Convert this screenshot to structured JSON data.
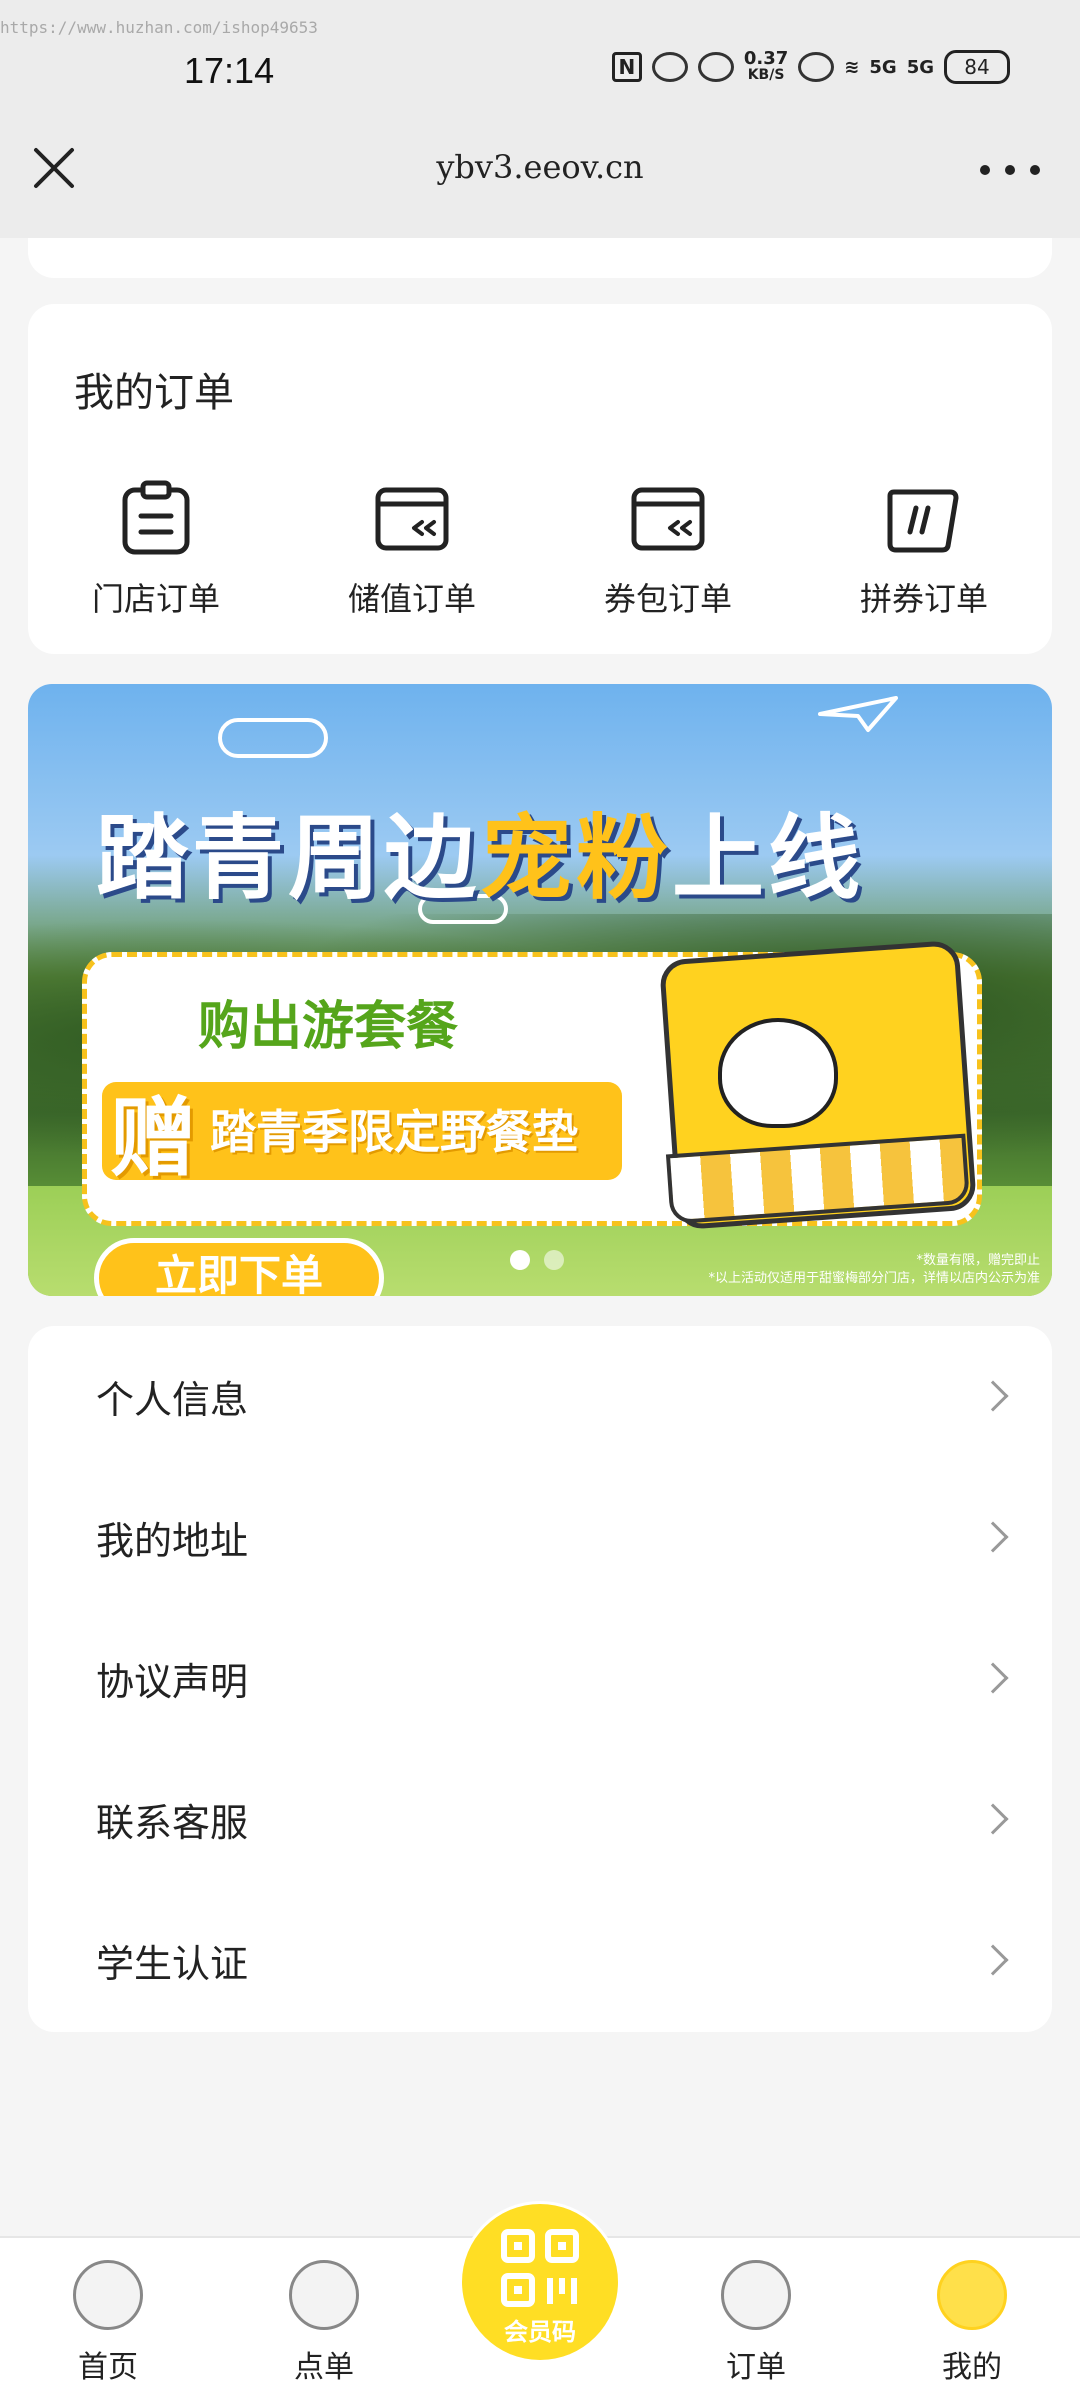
{
  "watermark": "https://www.huzhan.com/ishop49653",
  "status_bar": {
    "time": "17:14",
    "net_speed_value": "0.37",
    "net_speed_unit": "KB/S",
    "signal_1": "5G",
    "signal_2": "5G",
    "battery": "84"
  },
  "browser": {
    "url": "ybv3.eeov.cn"
  },
  "orders": {
    "title": "我的订单",
    "items": [
      {
        "label": "门店订单",
        "icon": "clipboard-icon"
      },
      {
        "label": "储值订单",
        "icon": "card-rewind-icon"
      },
      {
        "label": "券包订单",
        "icon": "card-rewind-icon"
      },
      {
        "label": "拼券订单",
        "icon": "ticket-icon"
      }
    ]
  },
  "banner": {
    "headline_part1": "踏青周边",
    "headline_highlight": "宠粉",
    "headline_part2": "上线",
    "subtitle": "购出游套餐",
    "gift_char": "赠",
    "gift_text": "踏青季限定野餐垫",
    "cta": "立即下单",
    "fine_print_1": "*数量有限，赠完即止",
    "fine_print_2": "*以上活动仅适用于甜蜜梅部分门店，详情以店内公示为准",
    "page_count": 2,
    "active_page": 1,
    "accent_color": "#ffc21a"
  },
  "menu": {
    "items": [
      {
        "label": "个人信息"
      },
      {
        "label": "我的地址"
      },
      {
        "label": "协议声明"
      },
      {
        "label": "联系客服"
      },
      {
        "label": "学生认证"
      }
    ]
  },
  "bottom_nav": {
    "items": [
      {
        "label": "首页",
        "icon": "home-icon"
      },
      {
        "label": "点单",
        "icon": "order-food-icon"
      },
      {
        "label": "订单",
        "icon": "orders-icon"
      },
      {
        "label": "我的",
        "icon": "profile-icon",
        "active": true
      }
    ],
    "member_label": "会员码"
  }
}
